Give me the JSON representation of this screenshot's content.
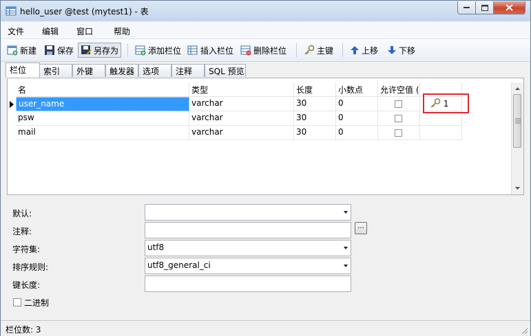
{
  "window": {
    "title": "hello_user @test (mytest1) - 表"
  },
  "menu": [
    "文件",
    "编辑",
    "窗口",
    "帮助"
  ],
  "toolbar": {
    "new": "新建",
    "save": "保存",
    "save_as": "另存为",
    "add_field": "添加栏位",
    "insert_field": "插入栏位",
    "delete_field": "删除栏位",
    "primary_key": "主键",
    "move_up": "上移",
    "move_down": "下移"
  },
  "tabs": [
    "栏位",
    "索引",
    "外键",
    "触发器",
    "选项",
    "注释",
    "SQL 预览"
  ],
  "grid": {
    "headers": [
      "名",
      "类型",
      "长度",
      "小数点",
      "允许空值 ("
    ],
    "rows": [
      {
        "name": "user_name",
        "type": "varchar",
        "length": "30",
        "decimal": "0",
        "key": "1"
      },
      {
        "name": "psw",
        "type": "varchar",
        "length": "30",
        "decimal": "0",
        "key": ""
      },
      {
        "name": "mail",
        "type": "varchar",
        "length": "30",
        "decimal": "0",
        "key": ""
      }
    ]
  },
  "props": {
    "default_label": "默认:",
    "default_value": "",
    "comment_label": "注释:",
    "comment_value": "",
    "charset_label": "字符集:",
    "charset_value": "utf8",
    "collation_label": "排序规则:",
    "collation_value": "utf8_general_ci",
    "key_length_label": "键长度:",
    "key_length_value": "",
    "binary_label": "二进制",
    "ellipsis": "..."
  },
  "status": {
    "text": "栏位数: 3"
  },
  "colors": {
    "selection": "#3399ff",
    "highlight_box": "#e0272d"
  }
}
